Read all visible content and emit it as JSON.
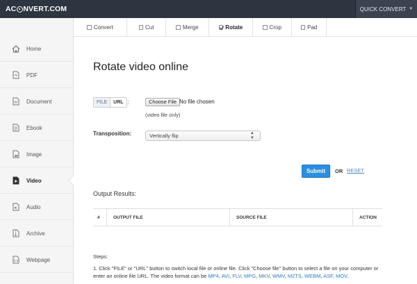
{
  "header": {
    "logo_left": "AC",
    "logo_right": "NVERT.COM",
    "quick_convert": "QUICK CONVERT"
  },
  "sidebar": {
    "items": [
      {
        "label": "Home",
        "icon": "home-icon"
      },
      {
        "label": "PDF",
        "icon": "pdf-icon"
      },
      {
        "label": "Document",
        "icon": "document-icon"
      },
      {
        "label": "Ebook",
        "icon": "ebook-icon"
      },
      {
        "label": "Image",
        "icon": "image-icon"
      },
      {
        "label": "Video",
        "icon": "video-icon",
        "active": true
      },
      {
        "label": "Audio",
        "icon": "audio-icon"
      },
      {
        "label": "Archive",
        "icon": "archive-icon"
      },
      {
        "label": "Webpage",
        "icon": "webpage-icon"
      }
    ]
  },
  "tabs": [
    {
      "label": "Convert",
      "checked": false
    },
    {
      "label": "Cut",
      "checked": false
    },
    {
      "label": "Merge",
      "checked": false
    },
    {
      "label": "Rotate",
      "checked": true
    },
    {
      "label": "Crop",
      "checked": false
    },
    {
      "label": "Pad",
      "checked": false
    }
  ],
  "main": {
    "title": "Rotate video online",
    "source_file": "FILE",
    "source_url": "URL",
    "source_colon": ":",
    "choose_file": "Choose File",
    "no_file": "No file chosen",
    "hint": "(video file only)",
    "transposition_label": "Transposition:",
    "transposition_value": "Vertically flip",
    "submit": "Submit",
    "or": "OR",
    "reset": "RESET",
    "output_label": "Output Results:",
    "table_headers": [
      "#",
      "OUTPUT FILE",
      "SOURCE FILE",
      "ACTION"
    ],
    "steps_label": "Steps:",
    "step1_text": "1. Click \"FILE\" or \"URL\" button to switch local file or online file. Click \"Choose file\" button to select a file on your computer or enter an online file URL. The video format can be",
    "formats": [
      "MP4",
      "AVI",
      "FLV",
      "MPG",
      "MKV",
      "WMV",
      "M2TS",
      "WEBM",
      "ASF",
      "MOV,"
    ]
  },
  "colors": {
    "topbar": "#2d3540",
    "accent": "#2c8fe0",
    "link": "#2f7fc4"
  }
}
